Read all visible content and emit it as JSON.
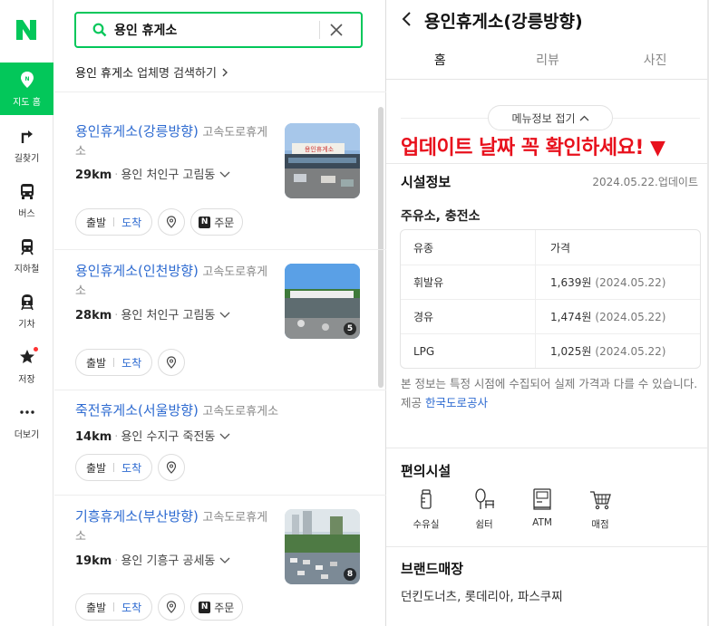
{
  "rail": {
    "items": [
      {
        "label": "지도 홈",
        "icon": "map-pin-icon",
        "active": true
      },
      {
        "label": "길찾기",
        "icon": "directions-icon"
      },
      {
        "label": "버스",
        "icon": "bus-icon"
      },
      {
        "label": "지하철",
        "icon": "subway-icon"
      },
      {
        "label": "기차",
        "icon": "train-icon"
      },
      {
        "label": "저장",
        "icon": "star-icon"
      },
      {
        "label": "더보기",
        "icon": "more-dots-icon"
      }
    ]
  },
  "search": {
    "query": "용인 휴게소",
    "suggest_query": "용인 휴게소",
    "suggest_suffix": "업체명 검색하기"
  },
  "results": [
    {
      "name": "용인휴게소(강릉방향)",
      "category": "고속도로휴게소",
      "distance": "29km",
      "address": "용인 처인구 고림동",
      "route_from": "출발",
      "route_to": "도착",
      "order": "주문",
      "photo_count": ""
    },
    {
      "name": "용인휴게소(인천방향)",
      "category": "고속도로휴게소",
      "distance": "28km",
      "address": "용인 처인구 고림동",
      "route_from": "출발",
      "route_to": "도착",
      "order": "",
      "photo_count": "5"
    },
    {
      "name": "죽전휴게소(서울방향)",
      "category": "고속도로휴게소",
      "distance": "14km",
      "address": "용인 수지구 죽전동",
      "route_from": "출발",
      "route_to": "도착",
      "order": "",
      "photo_count": ""
    },
    {
      "name": "기흥휴게소(부산방향)",
      "category": "고속도로휴게소",
      "distance": "19km",
      "address": "용인 기흥구 공세동",
      "route_from": "출발",
      "route_to": "도착",
      "order": "주문",
      "photo_count": "8"
    }
  ],
  "detail": {
    "title": "용인휴게소(강릉방향)",
    "tabs": [
      "홈",
      "리뷰",
      "사진"
    ],
    "active_tab": "홈",
    "fold_label": "메뉴정보 접기",
    "promo": "업데이트 날짜 꼭 확인하세요! ▼",
    "facility_title": "시설정보",
    "updated": "2024.05.22.업데이트",
    "fuel_title": "주유소, 충전소",
    "fuel_headers": [
      "유종",
      "가격"
    ],
    "fuel_rows": [
      {
        "type": "휘발유",
        "price": "1,639원",
        "date": "(2024.05.22)"
      },
      {
        "type": "경유",
        "price": "1,474원",
        "date": "(2024.05.22)"
      },
      {
        "type": "LPG",
        "price": "1,025원",
        "date": "(2024.05.22)"
      }
    ],
    "note": "본 정보는 특정 시점에 수집되어 실제 가격과 다를 수 있습니다.",
    "source_label": "제공",
    "source_name": "한국도로공사",
    "convenience_title": "편의시설",
    "amenities": [
      {
        "label": "수유실",
        "icon": "baby-bottle-icon"
      },
      {
        "label": "쉼터",
        "icon": "rest-area-icon"
      },
      {
        "label": "ATM",
        "icon": "atm-icon"
      },
      {
        "label": "매점",
        "icon": "shopping-cart-icon"
      }
    ],
    "brand_title": "브랜드매장",
    "brands": "던킨도너츠, 롯데리아, 파스쿠찌"
  },
  "colors": {
    "brand": "#03c75a",
    "link": "#2e6bd1",
    "promo": "#e8101c"
  }
}
